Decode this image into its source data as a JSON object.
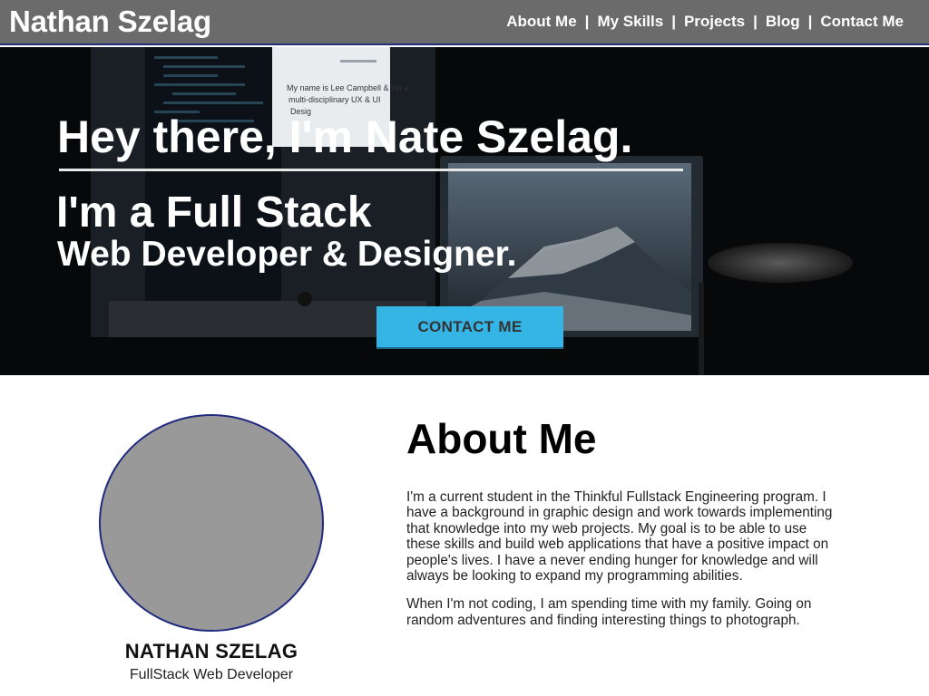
{
  "nav": {
    "brand": "Nathan Szelag",
    "separator": "|",
    "items": [
      {
        "label": "About Me"
      },
      {
        "label": "My Skills"
      },
      {
        "label": "Projects"
      },
      {
        "label": "Blog"
      },
      {
        "label": "Contact Me"
      }
    ]
  },
  "hero": {
    "title": "Hey there, I'm Nate Szelag.",
    "line1": "I'm a Full Stack",
    "line2": "Web Developer & Designer.",
    "cta_label": "CONTACT ME",
    "cta_color": "#35b4e6",
    "screen_text": [
      "My name is Lee Campbell & I'm a",
      "multi-disciplinary UX & UI",
      "Desig"
    ]
  },
  "about": {
    "name": "NATHAN SZELAG",
    "role": "FullStack Web Developer",
    "heading": "About Me",
    "paragraphs": [
      "I'm a current student in the Thinkful Fullstack Engineering program. I have a background in graphic design and work towards implementing that knowledge into my web projects. My goal is to be able to use these skills and build web applications that have a positive impact on people's lives. I have a never ending hunger for knowledge and will always be looking to expand my programming abilities.",
      "When I'm not coding, I am spending time with my family. Going on random adventures and finding interesting things to photograph."
    ]
  },
  "colors": {
    "nav_bg": "#6b6b6b",
    "nav_border": "#1f2f7a",
    "avatar_fill": "#999999",
    "avatar_border": "#1f2a80"
  }
}
